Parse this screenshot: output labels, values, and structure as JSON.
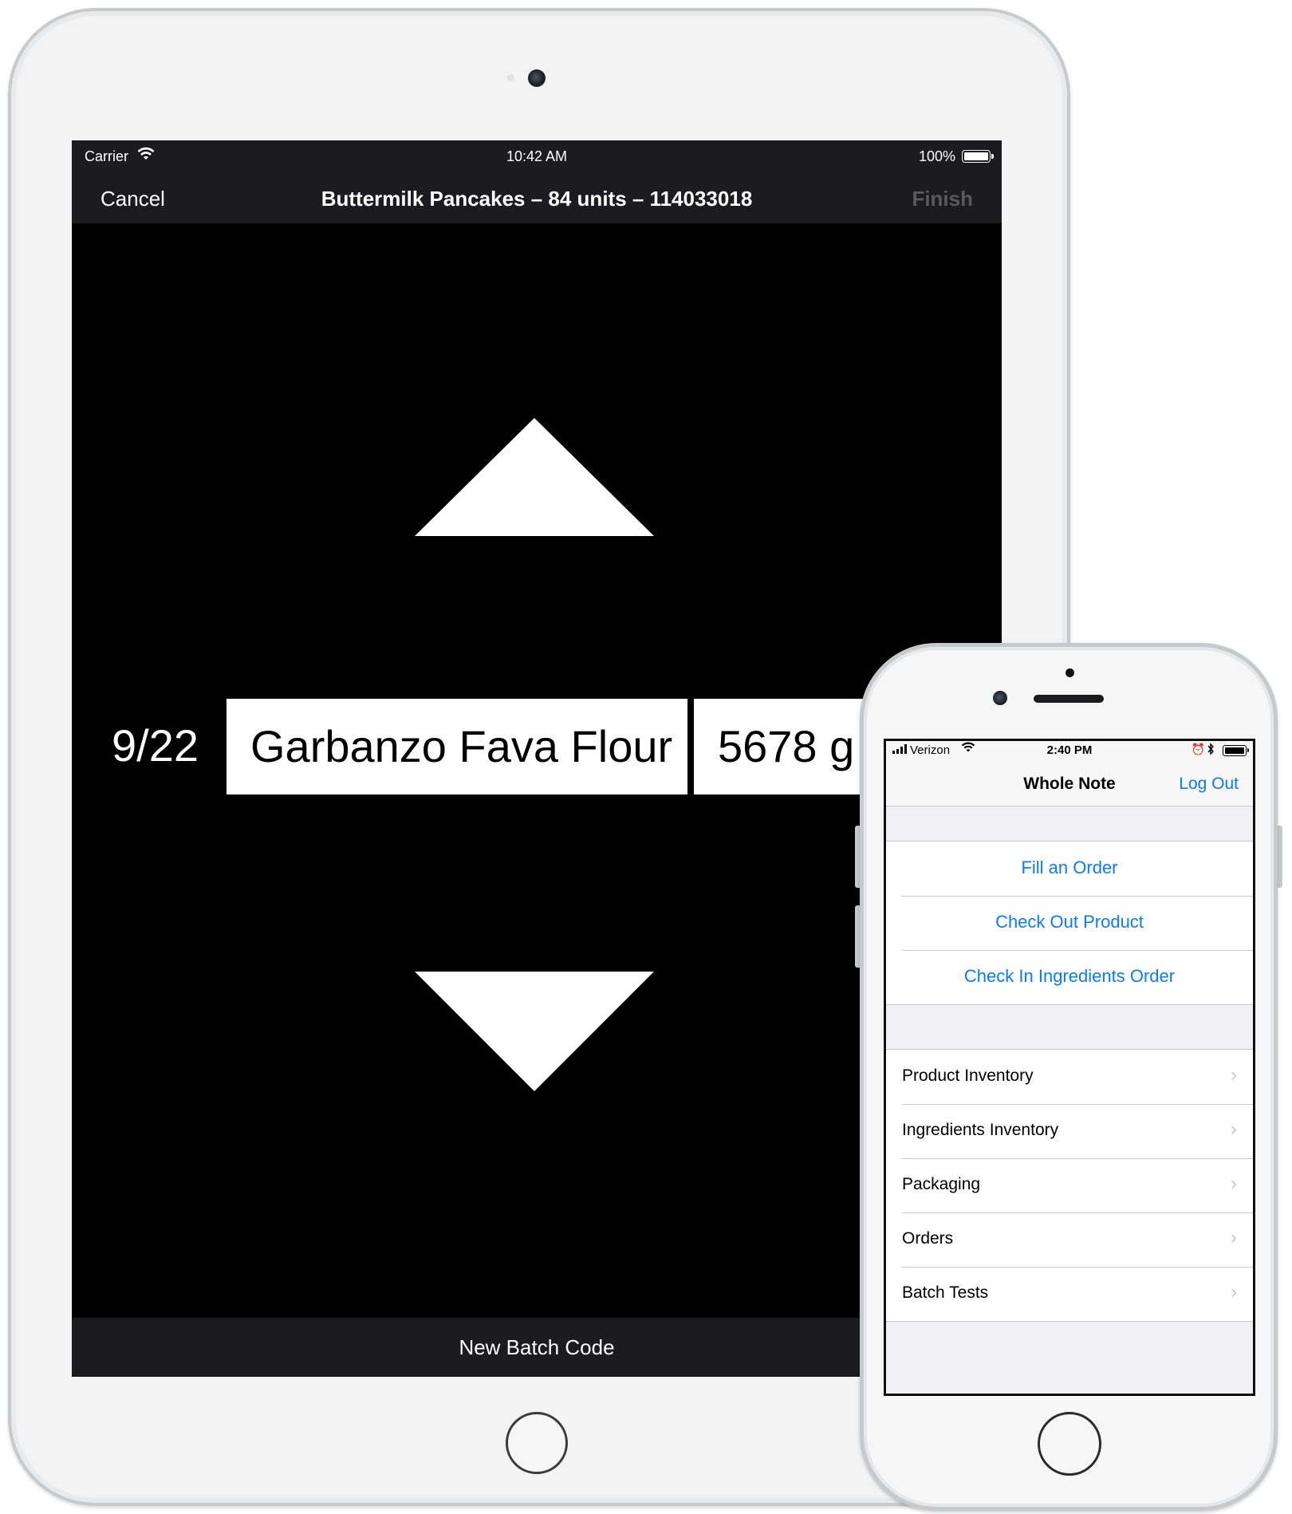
{
  "ipad": {
    "status": {
      "carrier": "Carrier",
      "time": "10:42 AM",
      "battery": "100%"
    },
    "nav": {
      "cancel": "Cancel",
      "title": "Buttermilk Pancakes – 84 units – 114033018",
      "finish": "Finish"
    },
    "row": {
      "index": "9/22",
      "ingredient": "Garbanzo Fava Flour",
      "quantity": "5678 g"
    },
    "bottom_button": "New Batch Code"
  },
  "iphone": {
    "status": {
      "carrier": "Verizon",
      "time": "2:40 PM"
    },
    "nav": {
      "title": "Whole Note",
      "logout": "Log Out"
    },
    "actions": [
      {
        "label": "Fill an Order"
      },
      {
        "label": "Check Out Product"
      },
      {
        "label": "Check In Ingredients Order"
      }
    ],
    "menu": [
      {
        "label": "Product Inventory"
      },
      {
        "label": "Ingredients Inventory"
      },
      {
        "label": "Packaging"
      },
      {
        "label": "Orders"
      },
      {
        "label": "Batch Tests"
      }
    ]
  },
  "colors": {
    "ios_blue": "#0a7aff",
    "nav_dark": "#1c1c1e",
    "finish_disabled": "#5a5a5e"
  },
  "icons": [
    "wifi-icon",
    "battery-icon",
    "chevron-right-icon",
    "up-arrow-icon",
    "down-arrow-icon",
    "alarm-icon",
    "bluetooth-icon",
    "signal-icon"
  ]
}
